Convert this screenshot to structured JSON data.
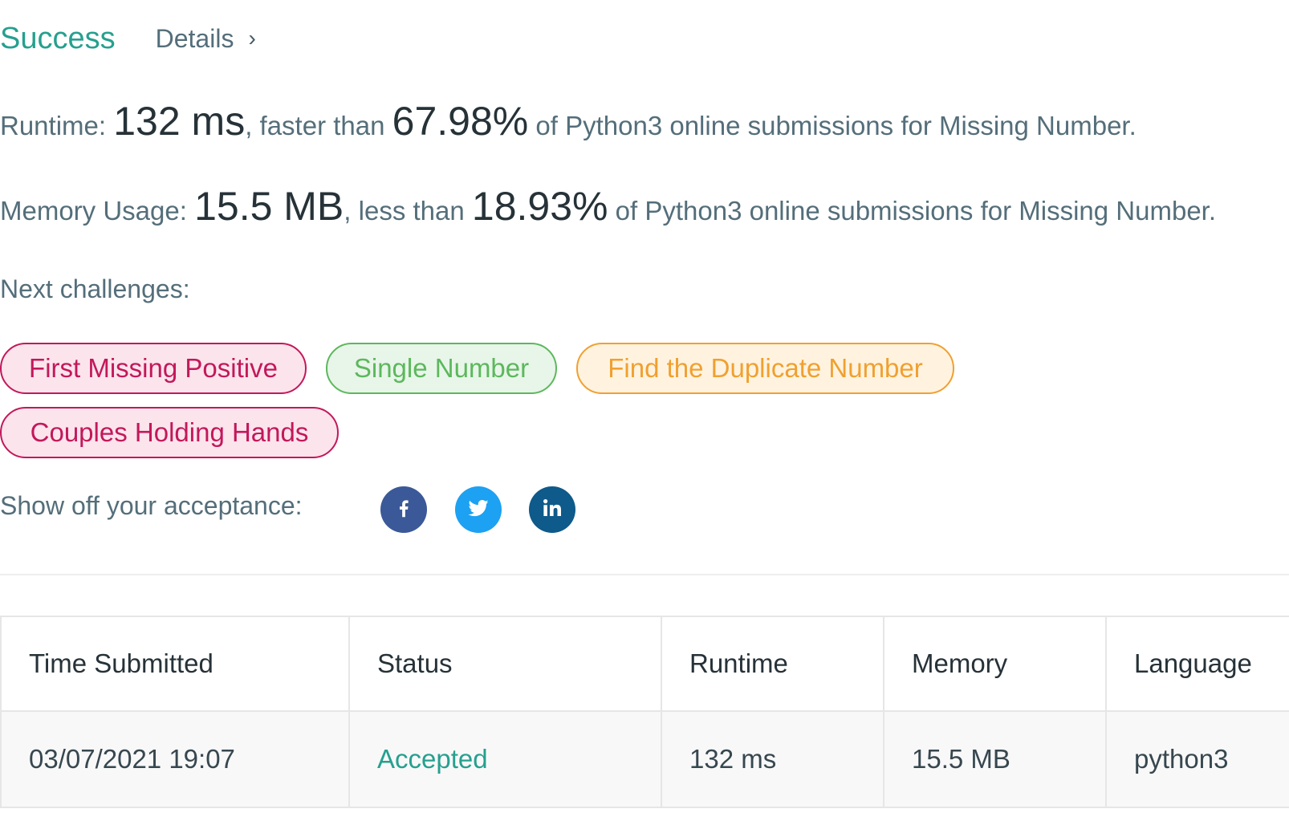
{
  "header": {
    "status": "Success",
    "details_label": "Details",
    "details_chevron": "›"
  },
  "runtime": {
    "label": "Runtime:",
    "value": "132 ms",
    "comparison": ", faster than",
    "percent": "67.98%",
    "suffix": "of Python3 online submissions for Missing Number."
  },
  "memory": {
    "label": "Memory Usage:",
    "value": "15.5 MB",
    "comparison": ", less than",
    "percent": "18.93%",
    "suffix": "of Python3 online submissions for Missing Number."
  },
  "next": {
    "label": "Next challenges:",
    "challenges": [
      {
        "title": "First Missing Positive",
        "difficulty": "hard",
        "color": "#c2185b"
      },
      {
        "title": "Single Number",
        "difficulty": "easy",
        "color": "#5cb85c"
      },
      {
        "title": "Find the Duplicate Number",
        "difficulty": "medium",
        "color": "#f0a030"
      },
      {
        "title": "Couples Holding Hands",
        "difficulty": "hard",
        "color": "#c2185b"
      }
    ]
  },
  "share": {
    "label": "Show off your acceptance:",
    "networks": [
      {
        "icon": "facebook-icon",
        "color": "#3b5998"
      },
      {
        "icon": "twitter-icon",
        "color": "#1da1f2"
      },
      {
        "icon": "linkedin-icon",
        "color": "#0e5a8a"
      }
    ]
  },
  "table": {
    "columns": [
      "Time Submitted",
      "Status",
      "Runtime",
      "Memory",
      "Language"
    ],
    "rows": [
      {
        "time": "03/07/2021 19:07",
        "status": "Accepted",
        "runtime": "132 ms",
        "memory": "15.5 MB",
        "language": "python3"
      }
    ]
  },
  "colors": {
    "success": "#26a08f",
    "text_muted": "#546e7a",
    "text_strong": "#263238"
  }
}
